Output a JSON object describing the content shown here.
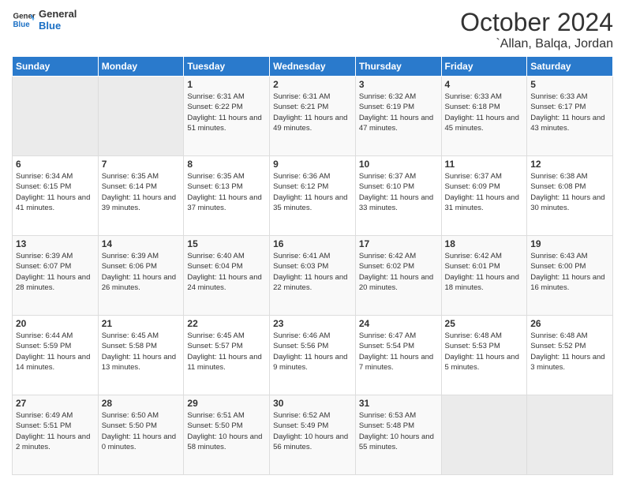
{
  "header": {
    "logo_line1": "General",
    "logo_line2": "Blue",
    "month": "October 2024",
    "location": "`Allan, Balqa, Jordan"
  },
  "weekdays": [
    "Sunday",
    "Monday",
    "Tuesday",
    "Wednesday",
    "Thursday",
    "Friday",
    "Saturday"
  ],
  "weeks": [
    [
      {
        "day": "",
        "info": ""
      },
      {
        "day": "",
        "info": ""
      },
      {
        "day": "1",
        "info": "Sunrise: 6:31 AM\nSunset: 6:22 PM\nDaylight: 11 hours and 51 minutes."
      },
      {
        "day": "2",
        "info": "Sunrise: 6:31 AM\nSunset: 6:21 PM\nDaylight: 11 hours and 49 minutes."
      },
      {
        "day": "3",
        "info": "Sunrise: 6:32 AM\nSunset: 6:19 PM\nDaylight: 11 hours and 47 minutes."
      },
      {
        "day": "4",
        "info": "Sunrise: 6:33 AM\nSunset: 6:18 PM\nDaylight: 11 hours and 45 minutes."
      },
      {
        "day": "5",
        "info": "Sunrise: 6:33 AM\nSunset: 6:17 PM\nDaylight: 11 hours and 43 minutes."
      }
    ],
    [
      {
        "day": "6",
        "info": "Sunrise: 6:34 AM\nSunset: 6:15 PM\nDaylight: 11 hours and 41 minutes."
      },
      {
        "day": "7",
        "info": "Sunrise: 6:35 AM\nSunset: 6:14 PM\nDaylight: 11 hours and 39 minutes."
      },
      {
        "day": "8",
        "info": "Sunrise: 6:35 AM\nSunset: 6:13 PM\nDaylight: 11 hours and 37 minutes."
      },
      {
        "day": "9",
        "info": "Sunrise: 6:36 AM\nSunset: 6:12 PM\nDaylight: 11 hours and 35 minutes."
      },
      {
        "day": "10",
        "info": "Sunrise: 6:37 AM\nSunset: 6:10 PM\nDaylight: 11 hours and 33 minutes."
      },
      {
        "day": "11",
        "info": "Sunrise: 6:37 AM\nSunset: 6:09 PM\nDaylight: 11 hours and 31 minutes."
      },
      {
        "day": "12",
        "info": "Sunrise: 6:38 AM\nSunset: 6:08 PM\nDaylight: 11 hours and 30 minutes."
      }
    ],
    [
      {
        "day": "13",
        "info": "Sunrise: 6:39 AM\nSunset: 6:07 PM\nDaylight: 11 hours and 28 minutes."
      },
      {
        "day": "14",
        "info": "Sunrise: 6:39 AM\nSunset: 6:06 PM\nDaylight: 11 hours and 26 minutes."
      },
      {
        "day": "15",
        "info": "Sunrise: 6:40 AM\nSunset: 6:04 PM\nDaylight: 11 hours and 24 minutes."
      },
      {
        "day": "16",
        "info": "Sunrise: 6:41 AM\nSunset: 6:03 PM\nDaylight: 11 hours and 22 minutes."
      },
      {
        "day": "17",
        "info": "Sunrise: 6:42 AM\nSunset: 6:02 PM\nDaylight: 11 hours and 20 minutes."
      },
      {
        "day": "18",
        "info": "Sunrise: 6:42 AM\nSunset: 6:01 PM\nDaylight: 11 hours and 18 minutes."
      },
      {
        "day": "19",
        "info": "Sunrise: 6:43 AM\nSunset: 6:00 PM\nDaylight: 11 hours and 16 minutes."
      }
    ],
    [
      {
        "day": "20",
        "info": "Sunrise: 6:44 AM\nSunset: 5:59 PM\nDaylight: 11 hours and 14 minutes."
      },
      {
        "day": "21",
        "info": "Sunrise: 6:45 AM\nSunset: 5:58 PM\nDaylight: 11 hours and 13 minutes."
      },
      {
        "day": "22",
        "info": "Sunrise: 6:45 AM\nSunset: 5:57 PM\nDaylight: 11 hours and 11 minutes."
      },
      {
        "day": "23",
        "info": "Sunrise: 6:46 AM\nSunset: 5:56 PM\nDaylight: 11 hours and 9 minutes."
      },
      {
        "day": "24",
        "info": "Sunrise: 6:47 AM\nSunset: 5:54 PM\nDaylight: 11 hours and 7 minutes."
      },
      {
        "day": "25",
        "info": "Sunrise: 6:48 AM\nSunset: 5:53 PM\nDaylight: 11 hours and 5 minutes."
      },
      {
        "day": "26",
        "info": "Sunrise: 6:48 AM\nSunset: 5:52 PM\nDaylight: 11 hours and 3 minutes."
      }
    ],
    [
      {
        "day": "27",
        "info": "Sunrise: 6:49 AM\nSunset: 5:51 PM\nDaylight: 11 hours and 2 minutes."
      },
      {
        "day": "28",
        "info": "Sunrise: 6:50 AM\nSunset: 5:50 PM\nDaylight: 11 hours and 0 minutes."
      },
      {
        "day": "29",
        "info": "Sunrise: 6:51 AM\nSunset: 5:50 PM\nDaylight: 10 hours and 58 minutes."
      },
      {
        "day": "30",
        "info": "Sunrise: 6:52 AM\nSunset: 5:49 PM\nDaylight: 10 hours and 56 minutes."
      },
      {
        "day": "31",
        "info": "Sunrise: 6:53 AM\nSunset: 5:48 PM\nDaylight: 10 hours and 55 minutes."
      },
      {
        "day": "",
        "info": ""
      },
      {
        "day": "",
        "info": ""
      }
    ]
  ]
}
